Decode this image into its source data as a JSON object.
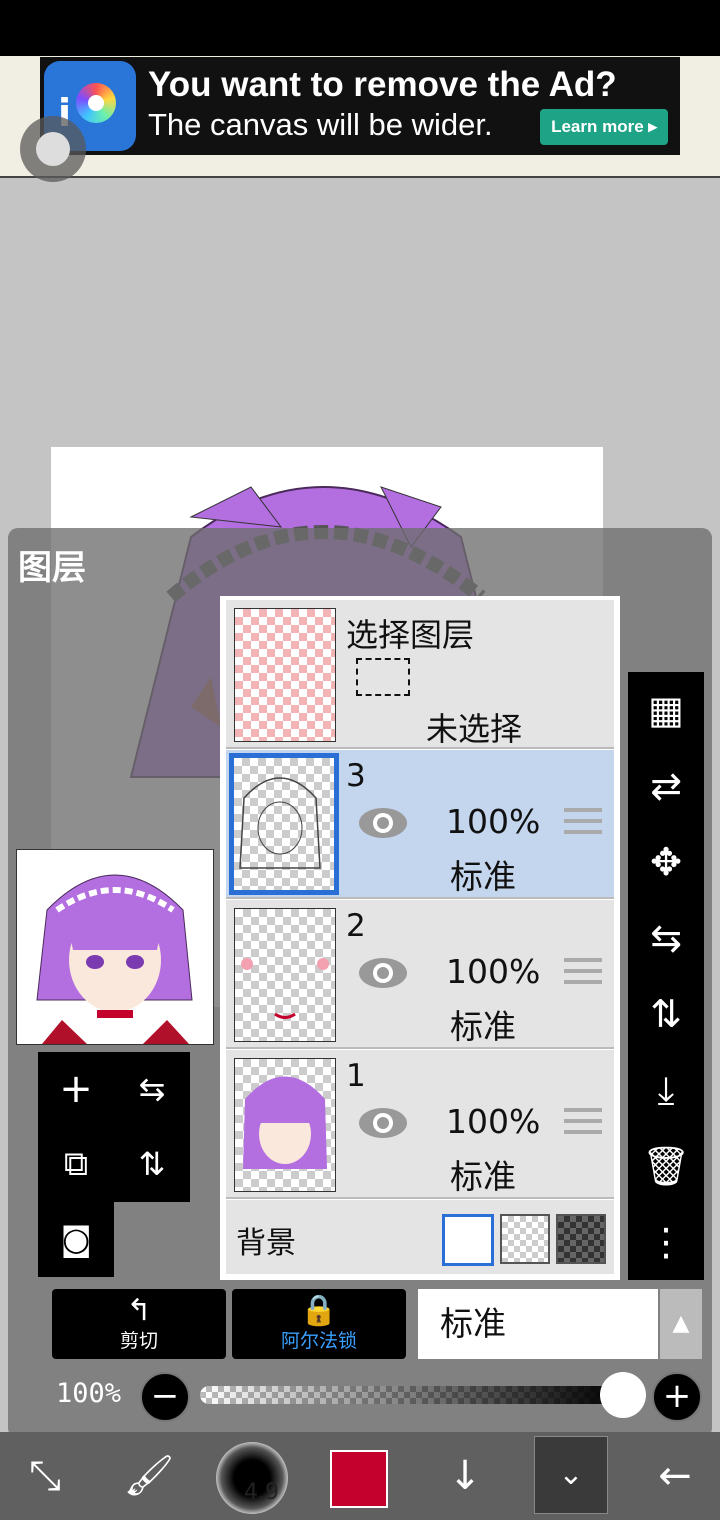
{
  "ad": {
    "title": "You want to remove the Ad?",
    "subtitle": "The canvas will be wider.",
    "button": "Learn more ▸"
  },
  "panel": {
    "title": "图层"
  },
  "selection_layer": {
    "title": "选择图层",
    "state": "未选择"
  },
  "layers": [
    {
      "number": "3",
      "opacity": "100%",
      "blend": "标准",
      "selected": true
    },
    {
      "number": "2",
      "opacity": "100%",
      "blend": "标准",
      "selected": false
    },
    {
      "number": "1",
      "opacity": "100%",
      "blend": "标准",
      "selected": false
    }
  ],
  "background": {
    "label": "背景"
  },
  "actions": {
    "clip": "剪切",
    "alpha_lock": "阿尔法锁"
  },
  "blend_mode": {
    "value": "标准"
  },
  "opacity": {
    "label": "100%",
    "value": 1.0
  },
  "brush": {
    "size": "4.9"
  },
  "colors": {
    "current": "#c4002c",
    "accent": "#2a6fd6",
    "alpha_lock": "#3aa0ff"
  },
  "icons": {
    "left": [
      "add-layer-icon",
      "flip-horizontal-icon",
      "duplicate-layer-icon",
      "flip-vertical-icon",
      "camera-icon"
    ],
    "right": [
      "transparency-icon",
      "swap-icon",
      "move-icon",
      "flip-h-icon",
      "flip-v-icon",
      "merge-down-icon",
      "trash-icon",
      "more-icon"
    ],
    "bottom": [
      "transform-icon",
      "brush-icon",
      "brush-size-icon",
      "color-icon",
      "download-icon",
      "layers-icon",
      "back-icon"
    ]
  }
}
